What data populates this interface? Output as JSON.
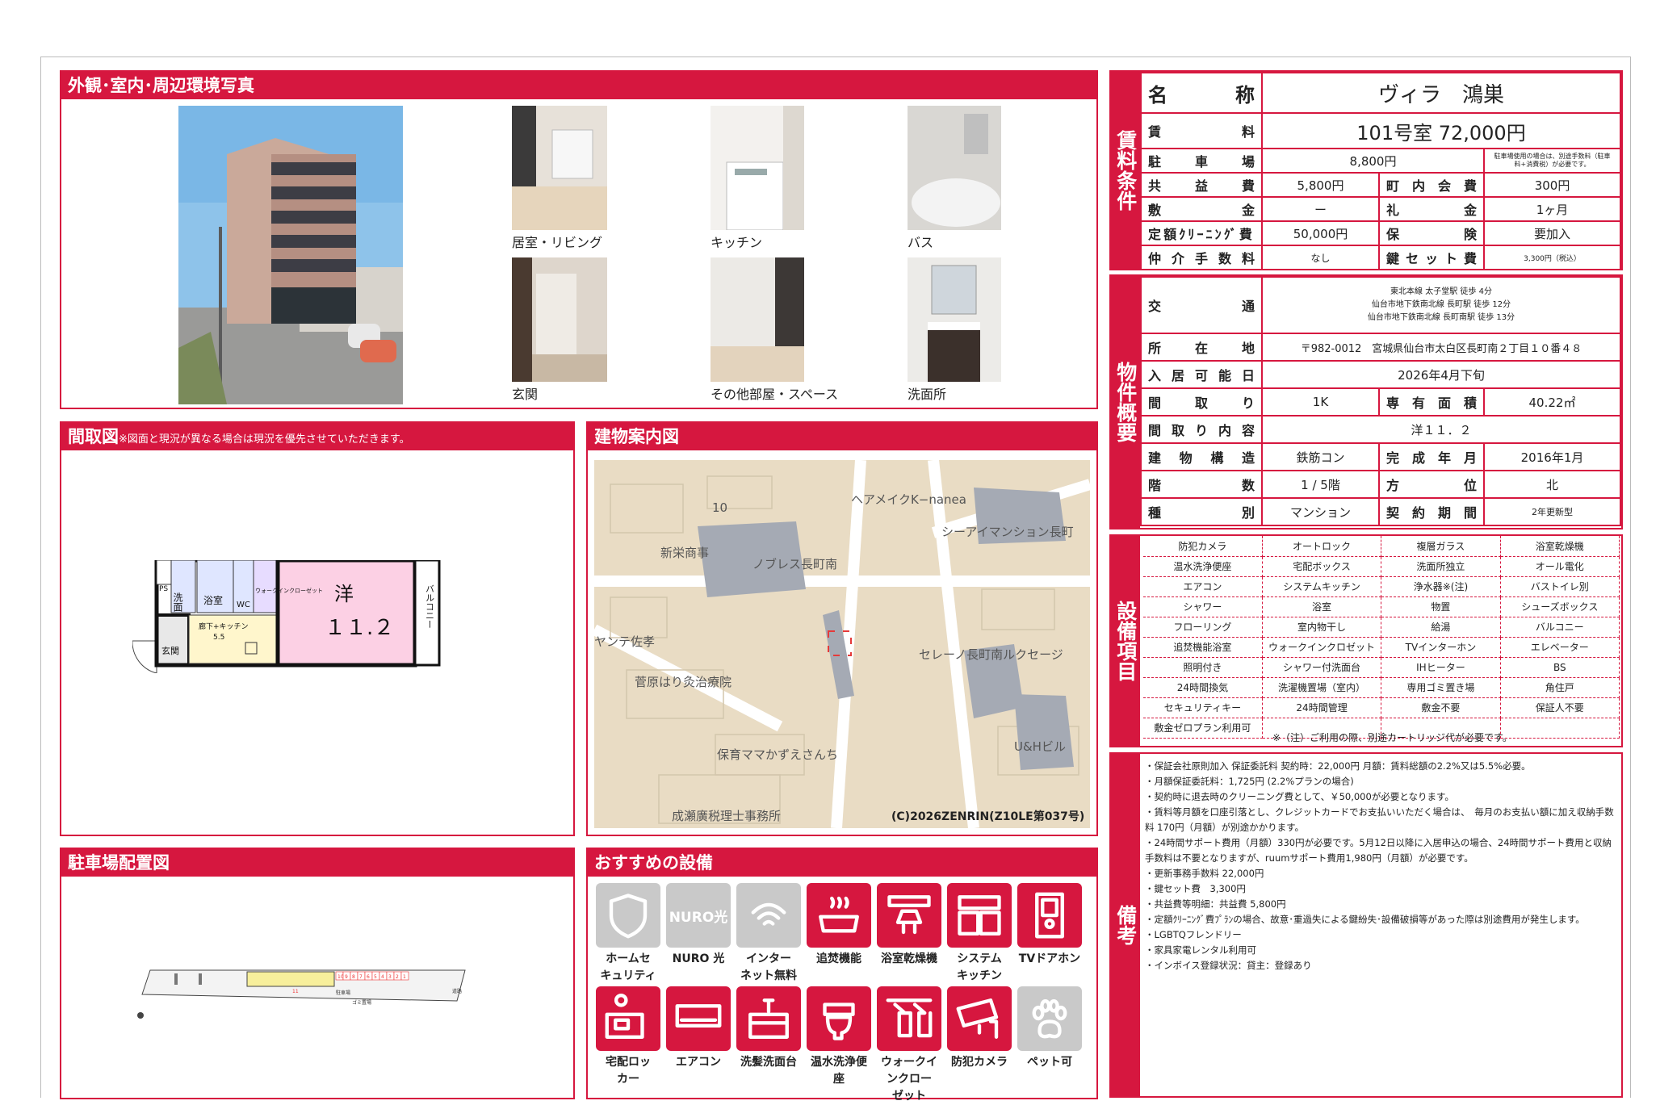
{
  "photos_section": {
    "title": "外観･室内･周辺環境写真",
    "captions": [
      "居室・リビング",
      "キッチン",
      "バス",
      "玄関",
      "その他部屋・スペース",
      "洗面所"
    ]
  },
  "floorplan": {
    "title": "間取図",
    "note": "※図面と現況が異なる場合は現況を優先させていただきます。",
    "room_label": "洋",
    "room_size": "１１.２",
    "labels": {
      "wash": "洗面",
      "bath": "浴室",
      "wc": "WC",
      "closet": "ウォークインクローゼット",
      "corridor": "廊下+キッチン",
      "corridor_size": "5.5",
      "entry": "玄関",
      "balcony": "バルコニー",
      "ps": "PS"
    }
  },
  "map": {
    "title": "建物案内図",
    "labels": [
      "ヘアメイクK−nanea",
      "シーアイマンション長町",
      "新栄商事",
      "ノブレス長町南",
      "ヤンテ佐孝",
      "菅原はり灸治療院",
      "セレーノ長町南ルクセージ",
      "U&Hビル",
      "保育ママかずえさんち",
      "成瀬廣税理士事務所",
      "10"
    ],
    "copyright": "(C)2026ZENRIN(Z10LE第037号)"
  },
  "parking": {
    "title": "駐車場配置図",
    "labels": [
      "駐車場",
      "道路",
      "ゴミ置場",
      "11"
    ],
    "numbers": [
      "10",
      "9",
      "8",
      "7",
      "6",
      "5",
      "4",
      "3",
      "2",
      "1"
    ]
  },
  "recommend": {
    "title": "おすすめの設備",
    "items": [
      {
        "label1": "ホームセ",
        "label2": "キュリティ",
        "icon": "shield-icon",
        "on": false
      },
      {
        "label1": "NURO 光",
        "label2": "",
        "icon": "nuro-icon",
        "on": false,
        "icon_text": "NURO光"
      },
      {
        "label1": "インター",
        "label2": "ネット無料",
        "icon": "wifi-icon",
        "on": false
      },
      {
        "label1": "追焚機能",
        "label2": "",
        "icon": "bathtub-icon",
        "on": true
      },
      {
        "label1": "浴室乾燥機",
        "label2": "",
        "icon": "dryer-icon",
        "on": true
      },
      {
        "label1": "システム",
        "label2": "キッチン",
        "icon": "kitchen-icon",
        "on": true
      },
      {
        "label1": "TVドアホン",
        "label2": "",
        "icon": "intercom-icon",
        "on": true
      },
      {
        "label1": "宅配ロッ",
        "label2": "カー",
        "icon": "delivery-box-icon",
        "on": true
      },
      {
        "label1": "エアコン",
        "label2": "",
        "icon": "aircon-icon",
        "on": true
      },
      {
        "label1": "洗髪洗面台",
        "label2": "",
        "icon": "washstand-icon",
        "on": true
      },
      {
        "label1": "温水洗浄便",
        "label2": "座",
        "icon": "toilet-icon",
        "on": true
      },
      {
        "label1": "ウォークイ",
        "label2": "ンクロー",
        "label3": "ゼット",
        "icon": "closet-icon",
        "on": true
      },
      {
        "label1": "防犯カメラ",
        "label2": "",
        "icon": "camera-icon",
        "on": true
      },
      {
        "label1": "ペット可",
        "label2": "",
        "icon": "paw-icon",
        "on": false
      }
    ]
  },
  "rent": {
    "section": "賃料条件",
    "name_label": "名　　称",
    "name": "ヴィラ　鴻巣",
    "rent_label": "賃　　　料",
    "rent": "101号室 72,000円",
    "parking_label": "駐　車　場",
    "parking": "8,800円",
    "parking_note": "駐車場使用の場合は、別途手数料（駐車料+消費税）が必要です。",
    "common_label": "共　益　費",
    "common": "5,800円",
    "town_label": "町　内　会　費",
    "town": "300円",
    "deposit_label": "敷　　　金",
    "deposit": "ー",
    "key_money_label": "礼　　　金",
    "key_money": "1ヶ月",
    "cleaning_label": "定額ｸﾘｰﾆﾝｸﾞ費",
    "cleaning": "50,000円",
    "insurance_label": "保　　　険",
    "insurance": "要加入",
    "agency_label": "仲 介 手 数 料",
    "agency": "なし",
    "key_label": "鍵 セ ッ ト 費",
    "key": "3,300円（税込）"
  },
  "property": {
    "section": "物件概要",
    "traffic_label": "交　　通",
    "traffic": [
      "東北本線 太子堂駅 徒歩 4分",
      "仙台市地下鉄南北線 長町駅 徒歩 12分",
      "仙台市地下鉄南北線 長町南駅 徒歩 13分"
    ],
    "address_label": "所　在　地",
    "address": "〒982-0012　宮城県仙台市太白区長町南２丁目１０番４８",
    "move_label": "入 居 可 能 日",
    "move": "2026年4月下旬",
    "layout_label": "間　取　り",
    "layout": "1K",
    "area_label": "専 有 面 積",
    "area": "40.22㎡",
    "layout_detail_label": "間 取 り 内 容",
    "layout_detail": "洋１１．２",
    "structure_label": "建 物 構 造",
    "structure": "鉄筋コン",
    "built_label": "完 成 年 月",
    "built": "2016年1月",
    "floor_label": "階　　数",
    "floor": "1 / 5階",
    "direction_label": "方　　位",
    "direction": "北",
    "type_label": "種　　別",
    "type": "マンション",
    "contract_label": "契 約 期 間",
    "contract": "2年更新型"
  },
  "equipment": {
    "section": "設備項目",
    "items": [
      "防犯カメラ",
      "オートロック",
      "複層ガラス",
      "浴室乾燥機",
      "温水洗浄便座",
      "宅配ボックス",
      "洗面所独立",
      "オール電化",
      "エアコン",
      "システムキッチン",
      "浄水器※(注)",
      "バストイレ別",
      "シャワー",
      "浴室",
      "物置",
      "シューズボックス",
      "フローリング",
      "室内物干し",
      "給湯",
      "バルコニー",
      "追焚機能浴室",
      "ウォークインクロゼット",
      "TVインターホン",
      "エレベーター",
      "照明付き",
      "シャワー付洗面台",
      "IHヒーター",
      "BS",
      "24時間換気",
      "洗濯機置場（室内）",
      "専用ゴミ置き場",
      "角住戸",
      "セキュリティキー",
      "24時間管理",
      "敷金不要",
      "保証人不要",
      "敷金ゼロプラン利用可"
    ],
    "note": "※（注）ご利用の際、別途カートリッジ代が必要です。"
  },
  "remarks": {
    "section": "備考",
    "lines": [
      "・保証会社原則加入 保証委託料 契約時：22,000円 月額：賃料総額の2.2%又は5.5%必要。",
      "・月額保証委託料：1,725円 (2.2%プランの場合)",
      "・契約時に退去時のクリーニング費として、￥50,000が必要となります。",
      "・賃料等月額を口座引落とし、クレジットカードでお支払いいただく場合は、　毎月のお支払い額に加え収納手数料 170円（月額）が別途かかります。",
      "・24時間サポート費用（月額）330円が必要です。5月12日以降に入居申込の場合、24時間サポート費用と収納手数料は不要となりますが、ruumサポート費用1,980円（月額）が必要です。",
      "・更新事務手数料 22,000円",
      "・鍵セット費　3,300円",
      "・共益費等明細：共益費 5,800円",
      "・定額ｸﾘｰﾆﾝｸﾞ費ﾌﾟﾗﾝの場合、故意･重過失による鍵紛失･設備破損等があった際は別途費用が発生します。",
      "・LGBTQフレンドリー",
      "・家具家電レンタル利用可",
      "・インボイス登録状況：貸主：登録あり"
    ]
  },
  "colors": {
    "accent": "#d6173f",
    "map_bg": "#e9dcc4",
    "building": "#a5aab4"
  }
}
